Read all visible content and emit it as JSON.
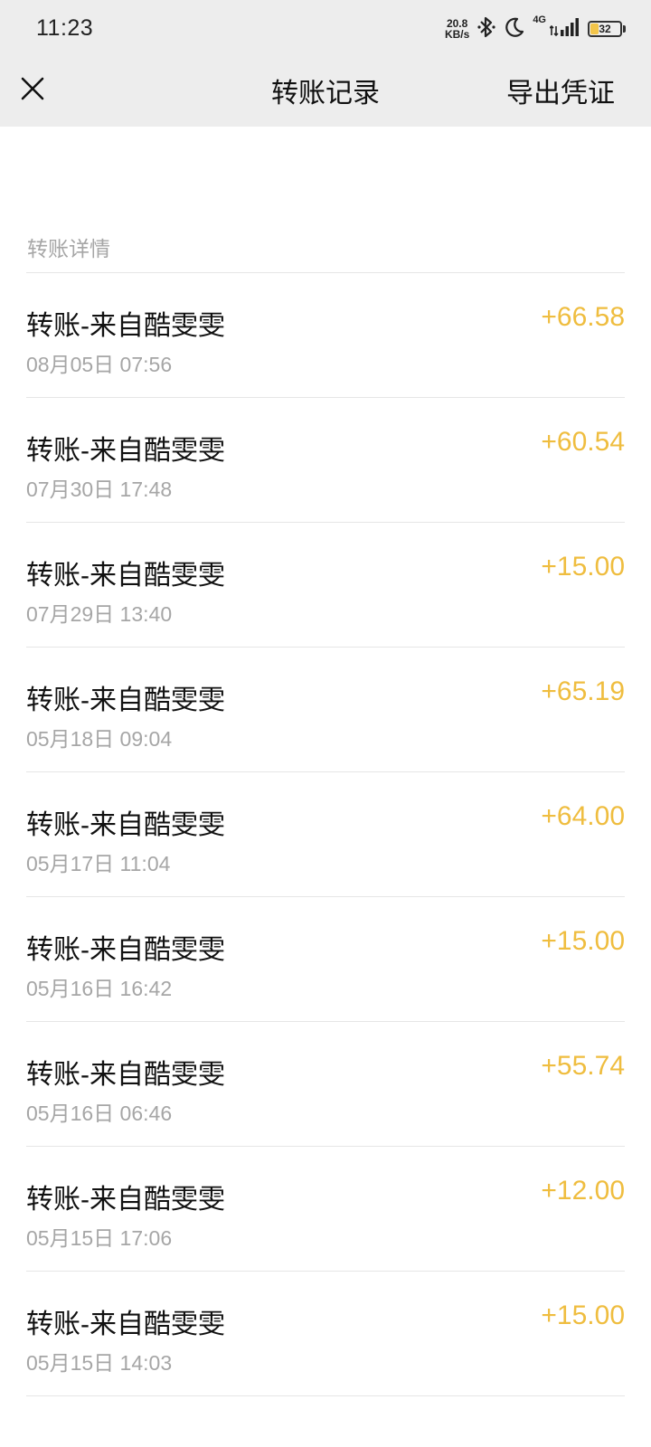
{
  "status_bar": {
    "time": "11:23",
    "netspeed_value": "20.8",
    "netspeed_unit": "KB/s",
    "network": "4G",
    "battery": "32",
    "battery_level_pct": 32,
    "icons": [
      "bluetooth-icon",
      "moon-icon",
      "signal-icon",
      "battery-icon"
    ]
  },
  "header": {
    "title": "转账记录",
    "export_label": "导出凭证",
    "close_icon": "close-icon"
  },
  "section": {
    "label": "转账详情"
  },
  "colors": {
    "amount": "#efbd3f",
    "secondary_text": "#a6a6a6",
    "header_bg": "#ededed"
  },
  "transactions": [
    {
      "title": "转账-来自酷雯雯",
      "date": "08月05日 07:56",
      "amount": "+66.58"
    },
    {
      "title": "转账-来自酷雯雯",
      "date": "07月30日 17:48",
      "amount": "+60.54"
    },
    {
      "title": "转账-来自酷雯雯",
      "date": "07月29日 13:40",
      "amount": "+15.00"
    },
    {
      "title": "转账-来自酷雯雯",
      "date": "05月18日 09:04",
      "amount": "+65.19"
    },
    {
      "title": "转账-来自酷雯雯",
      "date": "05月17日 11:04",
      "amount": "+64.00"
    },
    {
      "title": "转账-来自酷雯雯",
      "date": "05月16日 16:42",
      "amount": "+15.00"
    },
    {
      "title": "转账-来自酷雯雯",
      "date": "05月16日 06:46",
      "amount": "+55.74"
    },
    {
      "title": "转账-来自酷雯雯",
      "date": "05月15日 17:06",
      "amount": "+12.00"
    },
    {
      "title": "转账-来自酷雯雯",
      "date": "05月15日 14:03",
      "amount": "+15.00"
    }
  ]
}
